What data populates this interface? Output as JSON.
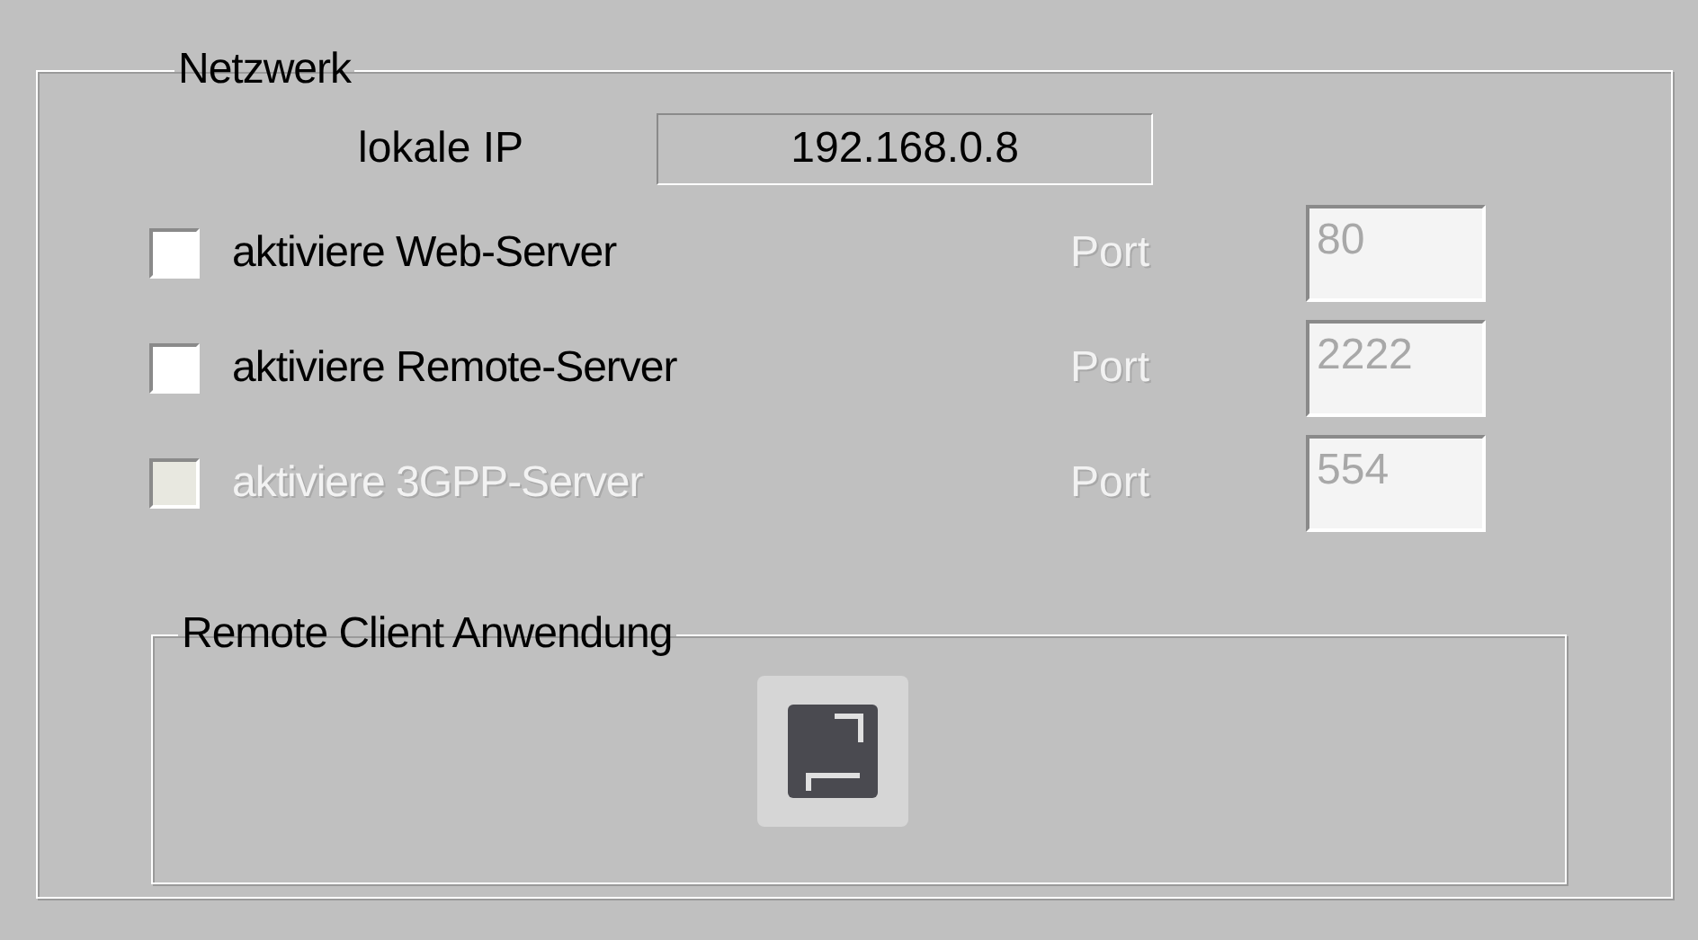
{
  "network_group": {
    "title": "Netzwerk",
    "local_ip": {
      "label": "lokale IP",
      "value": "192.168.0.8"
    },
    "servers": [
      {
        "label": "aktiviere Web-Server",
        "checked": false,
        "disabled": false,
        "port_label": "Port",
        "port_value": "80",
        "port_disabled": true
      },
      {
        "label": "aktiviere Remote-Server",
        "checked": false,
        "disabled": false,
        "port_label": "Port",
        "port_value": "2222",
        "port_disabled": true
      },
      {
        "label": "aktiviere 3GPP-Server",
        "checked": false,
        "disabled": true,
        "port_label": "Port",
        "port_value": "554",
        "port_disabled": true
      }
    ],
    "remote_client_group": {
      "title": "Remote Client Anwendung"
    }
  }
}
